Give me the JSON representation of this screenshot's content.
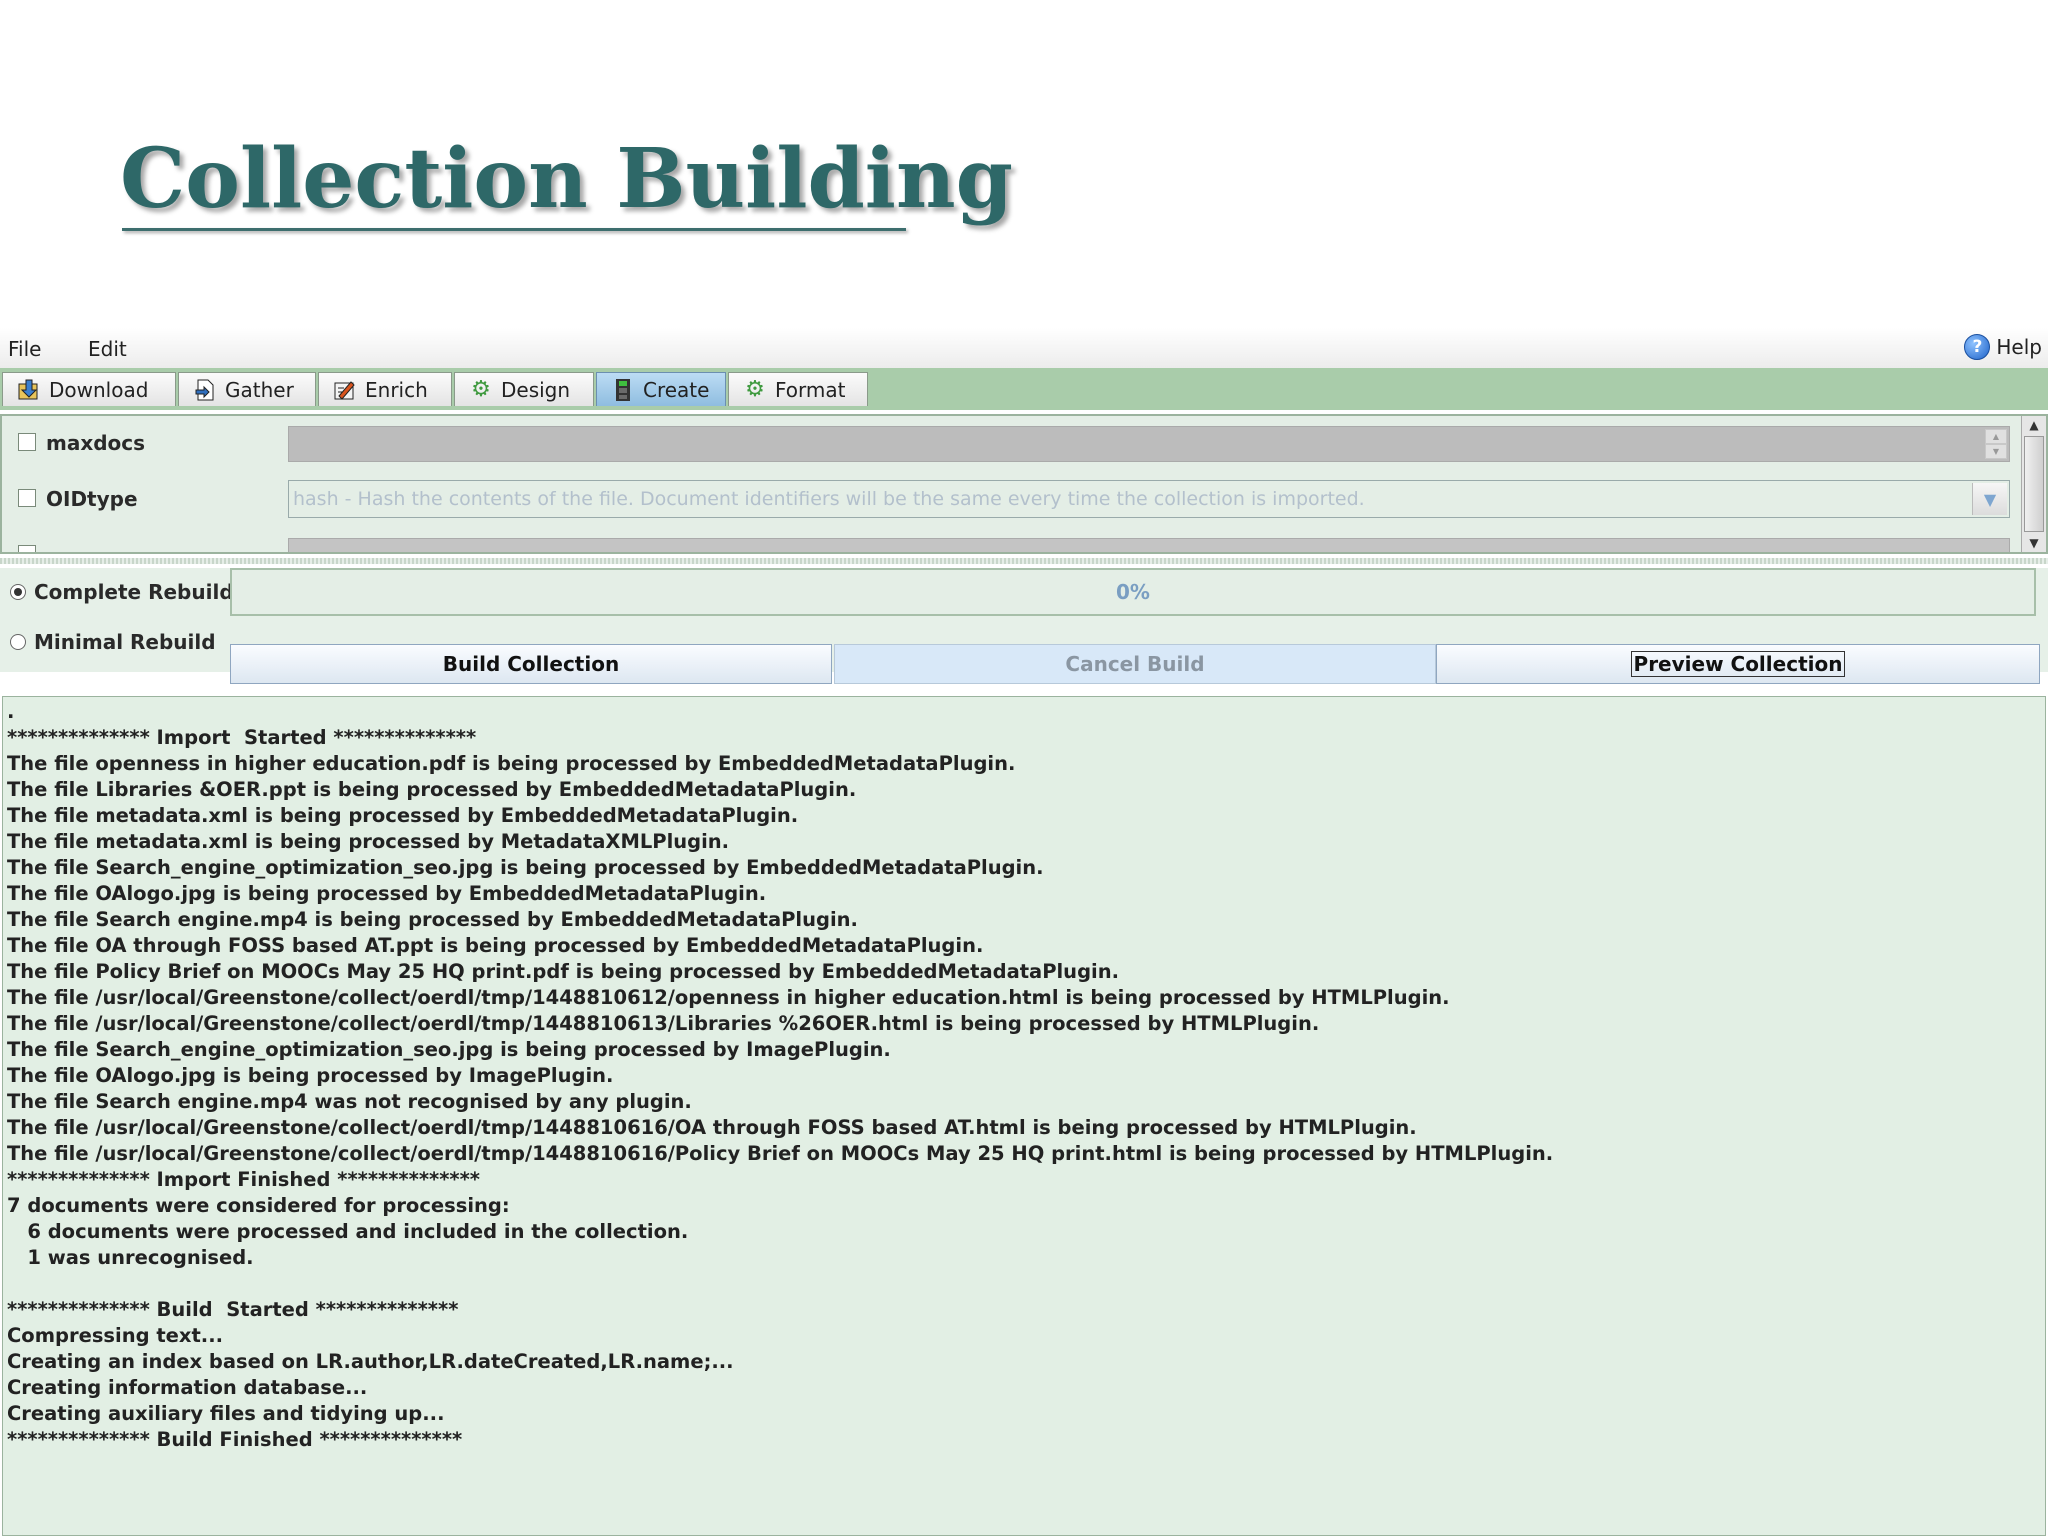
{
  "slide": {
    "title": "Collection Building"
  },
  "menubar": {
    "file": "File",
    "edit": "Edit",
    "help": "Help"
  },
  "tabs": [
    {
      "label": "Download",
      "icon": "download-icon"
    },
    {
      "label": "Gather",
      "icon": "gather-icon"
    },
    {
      "label": "Enrich",
      "icon": "enrich-icon"
    },
    {
      "label": "Design",
      "icon": "design-gear-icon"
    },
    {
      "label": "Create",
      "icon": "create-icon"
    },
    {
      "label": "Format",
      "icon": "format-gear-icon"
    }
  ],
  "active_tab": "Create",
  "options": {
    "maxdocs": {
      "label": "maxdocs",
      "checked": false
    },
    "oidtype": {
      "label": "OIDtype",
      "checked": false,
      "value": "hash - Hash the contents of the file. Document identifiers will be the same every time the collection is imported."
    }
  },
  "build": {
    "complete_rebuild": "Complete Rebuild",
    "minimal_rebuild": "Minimal Rebuild",
    "selected": "Complete Rebuild",
    "progress_text": "0%",
    "progress_value": 0,
    "build_button": "Build Collection",
    "cancel_button": "Cancel Build",
    "preview_button": "Preview Collection"
  },
  "log_lines": [
    ".",
    "************** Import  Started **************",
    "The file openness in higher education.pdf is being processed by EmbeddedMetadataPlugin.",
    "The file Libraries &OER.ppt is being processed by EmbeddedMetadataPlugin.",
    "The file metadata.xml is being processed by EmbeddedMetadataPlugin.",
    "The file metadata.xml is being processed by MetadataXMLPlugin.",
    "The file Search_engine_optimization_seo.jpg is being processed by EmbeddedMetadataPlugin.",
    "The file OAlogo.jpg is being processed by EmbeddedMetadataPlugin.",
    "The file Search engine.mp4 is being processed by EmbeddedMetadataPlugin.",
    "The file OA through FOSS based AT.ppt is being processed by EmbeddedMetadataPlugin.",
    "The file Policy Brief on MOOCs May 25 HQ print.pdf is being processed by EmbeddedMetadataPlugin.",
    "The file /usr/local/Greenstone/collect/oerdl/tmp/1448810612/openness in higher education.html is being processed by HTMLPlugin.",
    "The file /usr/local/Greenstone/collect/oerdl/tmp/1448810613/Libraries %26OER.html is being processed by HTMLPlugin.",
    "The file Search_engine_optimization_seo.jpg is being processed by ImagePlugin.",
    "The file OAlogo.jpg is being processed by ImagePlugin.",
    "The file Search engine.mp4 was not recognised by any plugin.",
    "The file /usr/local/Greenstone/collect/oerdl/tmp/1448810616/OA through FOSS based AT.html is being processed by HTMLPlugin.",
    "The file /usr/local/Greenstone/collect/oerdl/tmp/1448810616/Policy Brief on MOOCs May 25 HQ print.html is being processed by HTMLPlugin.",
    "************** Import Finished **************",
    "7 documents were considered for processing:",
    "   6 documents were processed and included in the collection.",
    "   1 was unrecognised.",
    "",
    "************** Build  Started **************",
    "Compressing text...",
    "Creating an index based on LR.author,LR.dateCreated,LR.name;...",
    "Creating information database...",
    "Creating auxiliary files and tidying up...",
    "************** Build Finished **************"
  ]
}
